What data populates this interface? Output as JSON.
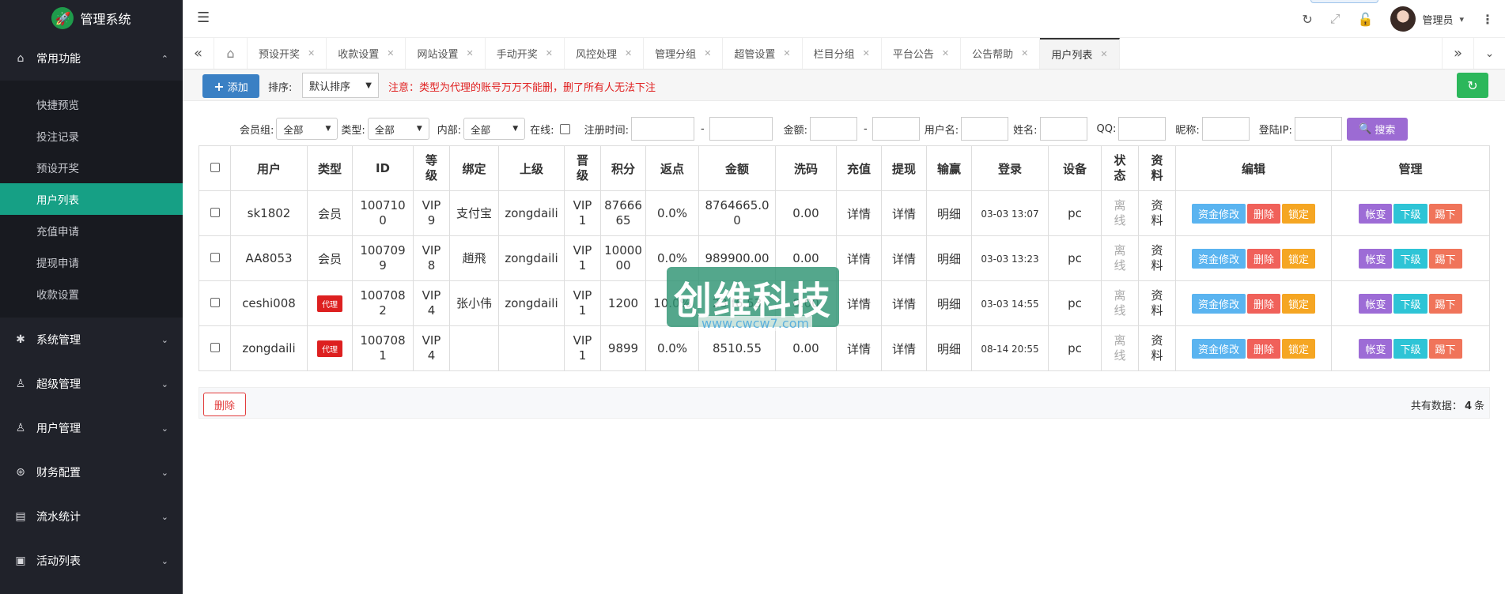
{
  "app": {
    "title": "管理系统"
  },
  "sidebar": {
    "groups": [
      {
        "label": "常用功能",
        "icon": "home-icon",
        "expanded": true,
        "items": [
          "快捷预览",
          "投注记录",
          "预设开奖",
          "用户列表",
          "充值申请",
          "提现申请",
          "收款设置"
        ]
      },
      {
        "label": "系统管理",
        "icon": "gear-icon"
      },
      {
        "label": "超级管理",
        "icon": "user-icon"
      },
      {
        "label": "用户管理",
        "icon": "users-icon"
      },
      {
        "label": "财务配置",
        "icon": "finance-icon"
      },
      {
        "label": "流水统计",
        "icon": "report-icon"
      },
      {
        "label": "活动列表",
        "icon": "gift-icon"
      }
    ],
    "active_item": "用户列表"
  },
  "header": {
    "admin_name": "管理员"
  },
  "tabs": [
    "预设开奖",
    "收款设置",
    "网站设置",
    "手动开奖",
    "风控处理",
    "管理分组",
    "超管设置",
    "栏目分组",
    "平台公告",
    "公告帮助",
    "用户列表"
  ],
  "toolbar": {
    "add_label": "添加",
    "sort_label": "排序:",
    "sort_value": "默认排序",
    "notice": "注意：类型为代理的账号万万不能删，删了所有人无法下注"
  },
  "filters": {
    "member_group_label": "会员组:",
    "member_group_value": "全部",
    "type_label": "类型:",
    "type_value": "全部",
    "internal_label": "内部:",
    "internal_value": "全部",
    "online_label": "在线:",
    "reg_time_label": "注册时间:",
    "dash": "-",
    "amount_label": "金额:",
    "username_label": "用户名:",
    "name_label": "姓名:",
    "qq_label": "QQ:",
    "nickname_label": "昵称:",
    "login_ip_label": "登陆IP:",
    "search_label": "搜索"
  },
  "table": {
    "headers": {
      "user": "用户",
      "type": "类型",
      "id": "ID",
      "level": "等级",
      "bind": "绑定",
      "parent": "上级",
      "promo": "晋级",
      "points": "积分",
      "rebate": "返点",
      "amount": "金额",
      "wash": "洗码",
      "recharge": "充值",
      "withdraw": "提现",
      "winloss": "输赢",
      "login": "登录",
      "device": "设备",
      "status": "状态",
      "profile": "资料",
      "edit": "编辑",
      "manage": "管理"
    },
    "rows": [
      {
        "user": "sk1802",
        "type": "会员",
        "id": "1007100",
        "level": "VIP9",
        "bind": "支付宝",
        "parent": "zongdaili",
        "promo": "VIP1",
        "points": "8766665",
        "rebate": "0.0%",
        "amount": "8764665.00",
        "wash": "0.00",
        "recharge": "详情",
        "withdraw": "详情",
        "winloss": "明细",
        "login": "03-03 13:07",
        "device": "pc",
        "status": "离线",
        "profile": "资料"
      },
      {
        "user": "AA8053",
        "type": "会员",
        "id": "1007099",
        "level": "VIP8",
        "bind": "趙飛",
        "parent": "zongdaili",
        "promo": "VIP1",
        "points": "1000000",
        "rebate": "0.0%",
        "amount": "989900.00",
        "wash": "0.00",
        "recharge": "详情",
        "withdraw": "详情",
        "winloss": "明细",
        "login": "03-03 13:23",
        "device": "pc",
        "status": "离线",
        "profile": "资料"
      },
      {
        "user": "ceshi008",
        "type": "代理",
        "id": "1007082",
        "level": "VIP4",
        "bind": "张小伟",
        "parent": "zongdaili",
        "promo": "VIP1",
        "points": "1200",
        "rebate": "10.0%",
        "amount": "23 f6.53",
        "wash": "0.00",
        "recharge": "详情",
        "withdraw": "详情",
        "winloss": "明细",
        "login": "03-03 14:55",
        "device": "pc",
        "status": "离线",
        "profile": "资料"
      },
      {
        "user": "zongdaili",
        "type": "代理",
        "id": "1007081",
        "level": "VIP4",
        "bind": "",
        "parent": "",
        "promo": "VIP1",
        "points": "9899",
        "rebate": "0.0%",
        "amount": "8510.55",
        "wash": "0.00",
        "recharge": "详情",
        "withdraw": "详情",
        "winloss": "明细",
        "login": "08-14 20:55",
        "device": "pc",
        "status": "离线",
        "profile": "资料"
      }
    ],
    "edit_buttons": [
      "资金修改",
      "删除",
      "锁定"
    ],
    "manage_buttons": [
      "帐变",
      "下级",
      "踢下"
    ]
  },
  "footer": {
    "delete_label": "删除",
    "total_prefix": "共有数据：",
    "total_count": "4",
    "total_suffix": "条"
  },
  "watermark": {
    "text": "创维科技",
    "url": "www.cwcw7.com"
  },
  "colors": {
    "sidebar_bg": "#20222a",
    "active_item": "#16a085",
    "primary": "#3a80c4",
    "danger": "#e02020",
    "search": "#9c6bd3",
    "refresh": "#2cb75b"
  }
}
